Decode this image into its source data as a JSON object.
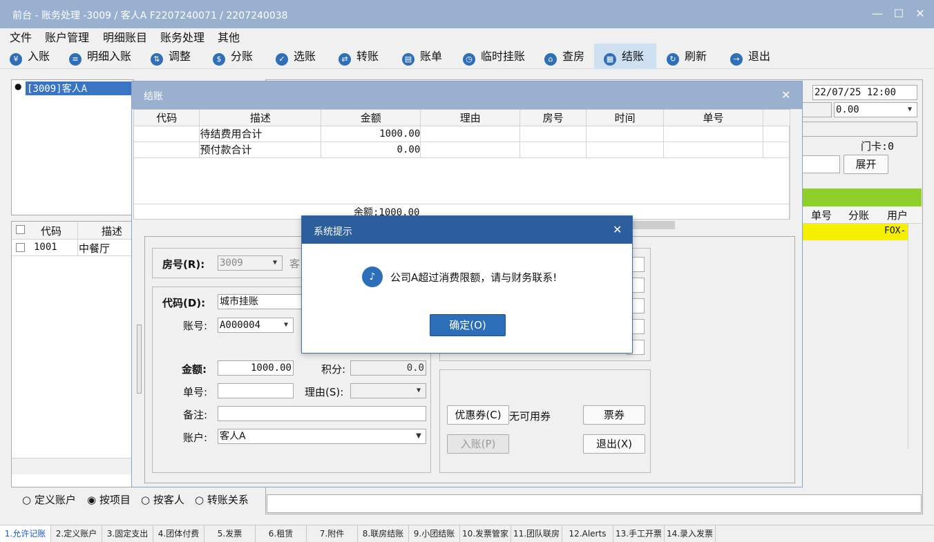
{
  "window": {
    "title": "前台 - 账务处理 -3009 / 客人A F2207240071 / 2207240038",
    "minimize": "—",
    "maximize": "☐",
    "close": "✕"
  },
  "menu": [
    "文件",
    "账户管理",
    "明细账目",
    "账务处理",
    "其他"
  ],
  "toolbar": [
    {
      "label": "入账",
      "icon": "¥"
    },
    {
      "label": "明细入账",
      "icon": "≡"
    },
    {
      "label": "调整",
      "icon": "⇅"
    },
    {
      "label": "分账",
      "icon": "$"
    },
    {
      "label": "选账",
      "icon": "✓"
    },
    {
      "label": "转账",
      "icon": "⇄"
    },
    {
      "label": "账单",
      "icon": "▤"
    },
    {
      "label": "临时挂账",
      "icon": "◷"
    },
    {
      "label": "查房",
      "icon": "⌂"
    },
    {
      "label": "结账",
      "icon": "▦"
    },
    {
      "label": "刷新",
      "icon": "↻"
    },
    {
      "label": "退出",
      "icon": "→"
    }
  ],
  "left": {
    "tree_item": "[3009]客人A",
    "acct_headers": [
      "代码",
      "描述"
    ],
    "acct_rows": [
      {
        "code": "1001",
        "desc": "中餐厅"
      }
    ],
    "radios": [
      "定义账户",
      "按项目",
      "按客人",
      "转账关系"
    ],
    "radio_selected": 1
  },
  "right": {
    "datetime": "22/07/25 12:00",
    "amount": "0.00",
    "door_card": "门卡:0",
    "expand": "展开",
    "col_order_no": "单号",
    "col_split": "分账",
    "col_user": "用户",
    "user_value": "FOX-",
    "highlight_color": "#f5f000",
    "header_color": "#8fcf2a"
  },
  "checkout": {
    "title": "结账",
    "headers": [
      "代码",
      "描述",
      "金额",
      "理由",
      "房号",
      "时间",
      "单号"
    ],
    "rows": [
      {
        "desc": "待结费用合计",
        "amount": "1000.00"
      },
      {
        "desc": "预付款合计",
        "amount": "0.00"
      }
    ],
    "balance": "余额:1000.00",
    "room_label": "房号(R):",
    "room_value": "3009",
    "guest_prefix": "客",
    "code_label": "代码(D):",
    "code_value": "城市挂账",
    "account_no_label": "账号:",
    "account_no_value": "A000004",
    "amount_label": "金额:",
    "amount_value": "1000.00",
    "points_label": "积分:",
    "points_value": "0.0",
    "order_label": "单号:",
    "reason_label": "理由(S):",
    "remark_label": "备注:",
    "account_label": "账户:",
    "account_value": "客人A",
    "coupon_btn": "优惠券(C)",
    "coupon_none": "无可用券",
    "ticket_btn": "票券",
    "post_btn": "入账(P)",
    "exit_btn": "退出(X)"
  },
  "dialog": {
    "title": "系统提示",
    "message": "公司A超过消费限额，请与财务联系!",
    "ok": "确定(O)"
  },
  "status_tabs": [
    "1.允许记账",
    "2.定义账户",
    "3.固定支出",
    "4.团体付费",
    "5.发票",
    "6.租赁",
    "7.附件",
    "8.联房结账",
    "9.小团结账",
    "10.发票管家",
    "11.团队联房",
    "12.Alerts",
    "13.手工开票",
    "14.录入发票"
  ]
}
